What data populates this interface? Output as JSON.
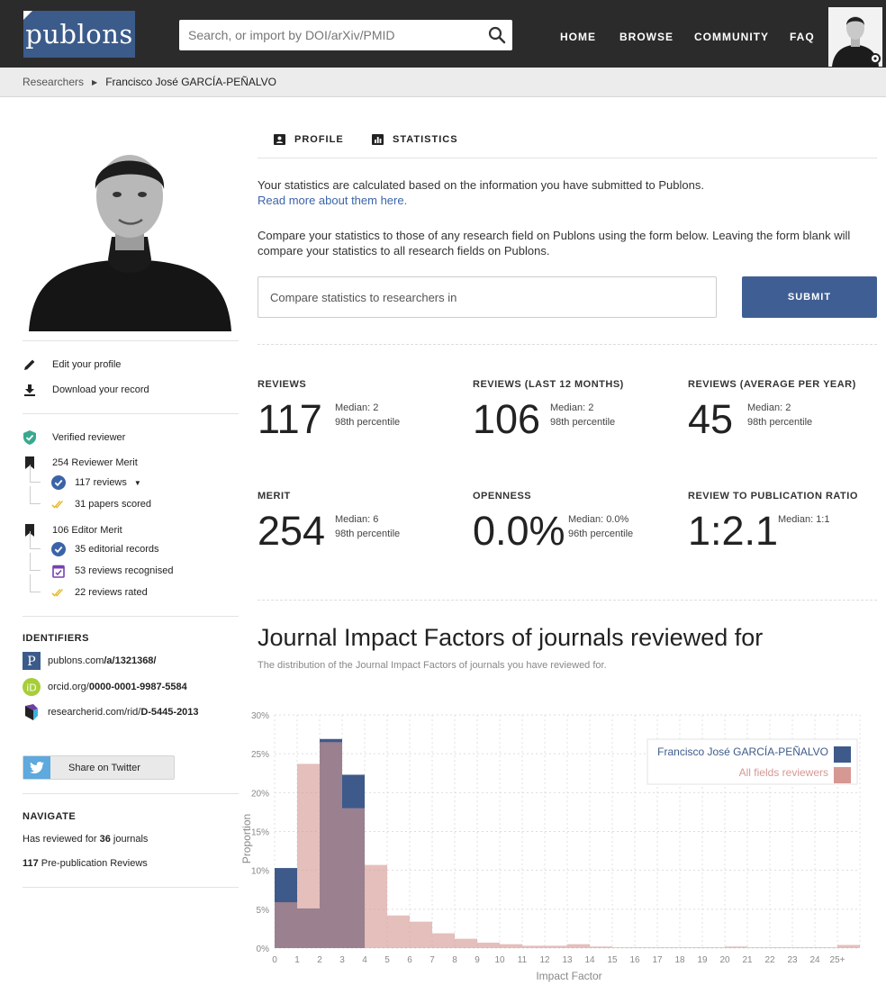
{
  "header": {
    "logo": "publons",
    "search_placeholder": "Search, or import by DOI/arXiv/PMID",
    "nav": [
      "HOME",
      "BROWSE",
      "COMMUNITY",
      "FAQ"
    ]
  },
  "breadcrumb": {
    "parent": "Researchers",
    "current": "Francisco José GARCÍA-PEÑALVO"
  },
  "sidebar": {
    "actions": [
      {
        "label": "Edit your profile",
        "icon": "pencil-icon"
      },
      {
        "label": "Download your record",
        "icon": "download-icon"
      }
    ],
    "verified": "Verified reviewer",
    "reviewer_merit": "254 Reviewer Merit",
    "reviewer_sub": [
      {
        "label": "117 reviews",
        "icon": "check-circle-icon"
      },
      {
        "label": "31 papers scored",
        "icon": "double-check-icon"
      }
    ],
    "editor_merit": "106 Editor Merit",
    "editor_sub": [
      {
        "label": "35 editorial records",
        "icon": "check-circle-icon"
      },
      {
        "label": "53 reviews recognised",
        "icon": "calendar-check-icon"
      },
      {
        "label": "22 reviews rated",
        "icon": "double-check-icon"
      }
    ],
    "identifiers_title": "IDENTIFIERS",
    "identifiers": [
      {
        "prefix": "publons.com",
        "value": "/a/1321368/"
      },
      {
        "prefix": "orcid.org/",
        "value": "0000-0001-9987-5584"
      },
      {
        "prefix": "researcherid.com/rid/",
        "value": "D-5445-2013"
      }
    ],
    "twitter": "Share on Twitter",
    "navigate_title": "NAVIGATE",
    "navigate": {
      "journals_pre": "Has reviewed for ",
      "journals_num": "36",
      "journals_post": " journals",
      "reviews_num": "117",
      "reviews_post": " Pre-publication Reviews"
    }
  },
  "tabs": [
    "PROFILE",
    "STATISTICS"
  ],
  "intro": {
    "line1": "Your statistics are calculated based on the information you have submitted to Publons.",
    "link": "Read more about them here.",
    "line2": "Compare your statistics to those of any research field on Publons using the form below. Leaving the form blank will compare your statistics to all research fields on Publons."
  },
  "compare_placeholder": "Compare statistics to researchers in",
  "submit_label": "SUBMIT",
  "stats": [
    {
      "label": "REVIEWS",
      "value": "117",
      "median": "Median: 2",
      "percentile": "98th percentile"
    },
    {
      "label": "REVIEWS (LAST 12 MONTHS)",
      "value": "106",
      "median": "Median: 2",
      "percentile": "98th percentile"
    },
    {
      "label": "REVIEWS (AVERAGE PER YEAR)",
      "value": "45",
      "median": "Median: 2",
      "percentile": "98th percentile"
    },
    {
      "label": "MERIT",
      "value": "254",
      "median": "Median: 6",
      "percentile": "98th percentile"
    },
    {
      "label": "OPENNESS",
      "value": "0.0%",
      "median": "Median: 0.0%",
      "percentile": "96th percentile"
    },
    {
      "label": "REVIEW TO PUBLICATION RATIO",
      "value": "1:2.1",
      "median": "Median: 1:1",
      "percentile": ""
    }
  ],
  "chart_title": "Journal Impact Factors of journals reviewed for",
  "chart_subtitle": "The distribution of the Journal Impact Factors of journals you have reviewed for.",
  "chart_data": {
    "type": "bar",
    "xlabel": "Impact Factor",
    "ylabel": "Proportion",
    "ylim": [
      0,
      30
    ],
    "yticks": [
      "0%",
      "5%",
      "10%",
      "15%",
      "20%",
      "25%",
      "30%"
    ],
    "categories": [
      "0",
      "1",
      "2",
      "3",
      "4",
      "5",
      "6",
      "7",
      "8",
      "9",
      "10",
      "11",
      "12",
      "13",
      "14",
      "15",
      "16",
      "17",
      "18",
      "19",
      "20",
      "21",
      "22",
      "23",
      "24",
      "25+"
    ],
    "series": [
      {
        "name": "Francisco José GARCÍA-PEÑALVO",
        "color": "#3d5a8a",
        "values": [
          10.3,
          5.1,
          26.9,
          22.3,
          0,
          0,
          0,
          0,
          0,
          0,
          0,
          0,
          0,
          0,
          0,
          0,
          0,
          0,
          0,
          0,
          0,
          0,
          0,
          0,
          0,
          0
        ]
      },
      {
        "name": "All fields reviewers",
        "color": "#d59893",
        "values": [
          5.9,
          23.7,
          26.5,
          18.0,
          10.7,
          4.2,
          3.4,
          1.9,
          1.2,
          0.7,
          0.5,
          0.3,
          0.3,
          0.5,
          0.2,
          0.1,
          0.1,
          0.1,
          0.1,
          0.1,
          0.2,
          0.1,
          0.1,
          0.1,
          0.1,
          0.4
        ]
      }
    ],
    "legend_position": "top-right",
    "grid": true
  }
}
